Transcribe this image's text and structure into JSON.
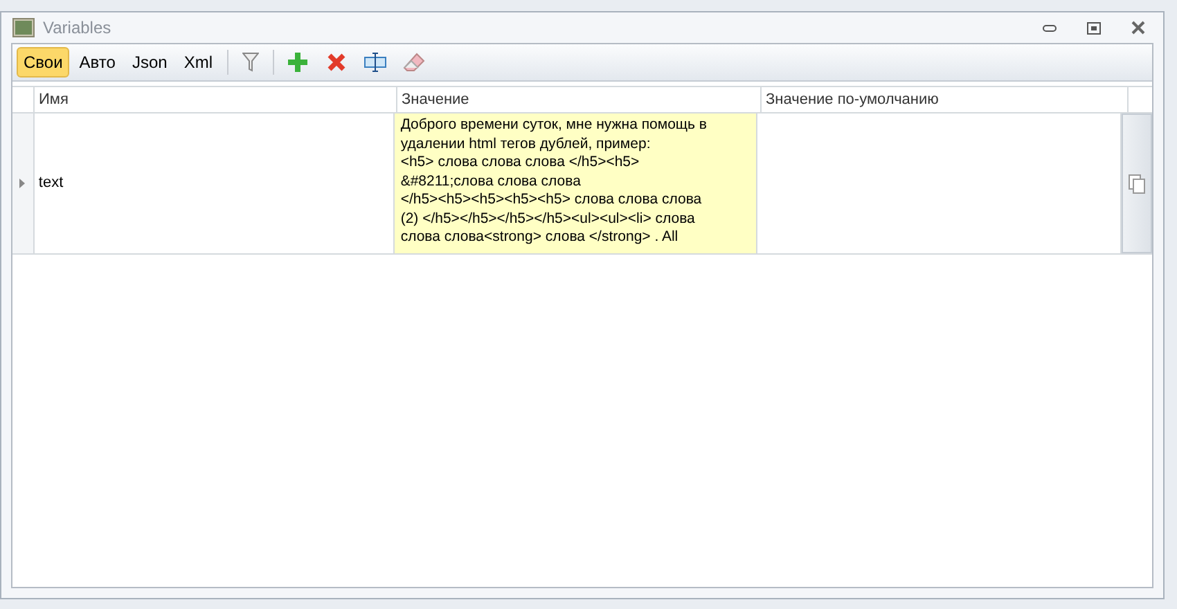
{
  "window": {
    "title": "Variables"
  },
  "tabs": [
    {
      "label": "Свои",
      "selected": true
    },
    {
      "label": "Авто",
      "selected": false
    },
    {
      "label": "Json",
      "selected": false
    },
    {
      "label": "Xml",
      "selected": false
    }
  ],
  "table": {
    "columns": [
      "Имя",
      "Значение",
      "Значение по-умолчанию"
    ],
    "rows": [
      {
        "name": "text",
        "value": "Доброго времени суток, мне нужна помощь в\nудалении html тегов дублей, пример:\n<h5> слова слова слова </h5><h5>\n&#8211;слова слова слова\n</h5><h5><h5><h5><h5> слова слова слова\n(2) </h5></h5></h5></h5><ul><ul><li> слова\nслова слова<strong> слова </strong> . All",
        "selected": true
      }
    ]
  }
}
